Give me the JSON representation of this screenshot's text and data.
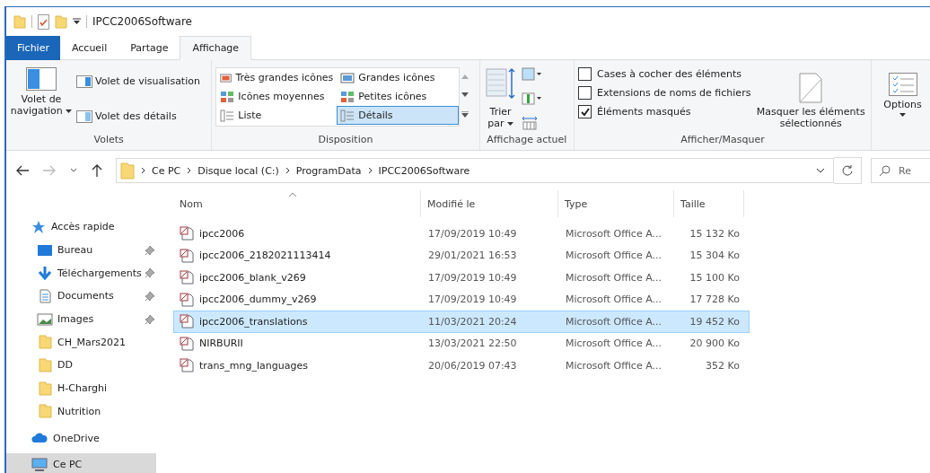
{
  "window": {
    "title": "IPCC2006Software"
  },
  "ribbon_tabs": [
    {
      "label": "Fichier",
      "kind": "file",
      "selected": false
    },
    {
      "label": "Accueil",
      "kind": "tab",
      "selected": false
    },
    {
      "label": "Partage",
      "kind": "tab",
      "selected": false
    },
    {
      "label": "Affichage",
      "kind": "tab",
      "selected": true
    }
  ],
  "ribbon": {
    "volets": {
      "label": "Volets",
      "navigation": "Volet de navigation",
      "panes": [
        {
          "label": "Volet de visualisation",
          "kind": "preview"
        },
        {
          "label": "Volet des détails",
          "kind": "details"
        }
      ]
    },
    "disposition": {
      "label": "Disposition",
      "layouts": [
        {
          "label": "Très grandes icônes",
          "kind": "xl",
          "selected": false
        },
        {
          "label": "Grandes icônes",
          "kind": "large",
          "selected": false
        },
        {
          "label": "Icônes moyennes",
          "kind": "medium",
          "selected": false
        },
        {
          "label": "Petites icônes",
          "kind": "small",
          "selected": false
        },
        {
          "label": "Liste",
          "kind": "list",
          "selected": false
        },
        {
          "label": "Détails",
          "kind": "details",
          "selected": true
        }
      ]
    },
    "current_view": {
      "label": "Affichage actuel",
      "sort": "Trier par"
    },
    "show_hide": {
      "label": "Afficher/Masquer",
      "checkboxes": [
        {
          "label": "Cases à cocher des éléments",
          "checked": false
        },
        {
          "label": "Extensions de noms de fichiers",
          "checked": false
        },
        {
          "label": "Éléments masqués",
          "checked": true
        }
      ],
      "hide_selected": "Masquer les éléments sélectionnés"
    },
    "options": "Options"
  },
  "address": {
    "breadcrumbs": [
      "Ce PC",
      "Disque local (C:)",
      "ProgramData",
      "IPCC2006Software"
    ],
    "search_placeholder": "Re"
  },
  "sidebar": [
    {
      "label": "Accès rapide",
      "kind": "star",
      "selected": false,
      "children": [
        {
          "label": "Bureau",
          "kind": "desktop",
          "pinned": true,
          "selected": false
        },
        {
          "label": "Téléchargements",
          "kind": "download",
          "pinned": true,
          "selected": false
        },
        {
          "label": "Documents",
          "kind": "document",
          "pinned": true,
          "selected": false
        },
        {
          "label": "Images",
          "kind": "image",
          "pinned": true,
          "selected": false
        },
        {
          "label": "CH_Mars2021",
          "kind": "folder",
          "pinned": false,
          "selected": false
        },
        {
          "label": "DD",
          "kind": "folder",
          "pinned": false,
          "selected": false
        },
        {
          "label": "H-Charghi",
          "kind": "folder",
          "pinned": false,
          "selected": false
        },
        {
          "label": "Nutrition",
          "kind": "folder",
          "pinned": false,
          "selected": false
        }
      ]
    },
    {
      "label": "OneDrive",
      "kind": "cloud",
      "selected": false
    },
    {
      "label": "Ce PC",
      "kind": "pc",
      "selected": true
    }
  ],
  "table": {
    "columns": [
      {
        "label": "Nom",
        "sorted": true
      },
      {
        "label": "Modifié le",
        "sorted": false
      },
      {
        "label": "Type",
        "sorted": false
      },
      {
        "label": "Taille",
        "sorted": false
      }
    ],
    "rows": [
      {
        "name": "ipcc2006",
        "modified": "17/09/2019 10:49",
        "type": "Microsoft Office A...",
        "size": "15 132 Ko",
        "selected": false
      },
      {
        "name": "ipcc2006_2182021113414",
        "modified": "29/01/2021 16:53",
        "type": "Microsoft Office A...",
        "size": "15 304 Ko",
        "selected": false
      },
      {
        "name": "ipcc2006_blank_v269",
        "modified": "17/09/2019 10:49",
        "type": "Microsoft Office A...",
        "size": "15 100 Ko",
        "selected": false
      },
      {
        "name": "ipcc2006_dummy_v269",
        "modified": "17/09/2019 10:49",
        "type": "Microsoft Office A...",
        "size": "17 728 Ko",
        "selected": false
      },
      {
        "name": "ipcc2006_translations",
        "modified": "11/03/2021 20:24",
        "type": "Microsoft Office A...",
        "size": "19 452 Ko",
        "selected": true
      },
      {
        "name": "NIRBURII",
        "modified": "13/03/2021 22:50",
        "type": "Microsoft Office A...",
        "size": "20 900 Ko",
        "selected": false
      },
      {
        "name": "trans_mng_languages",
        "modified": "20/06/2019 07:43",
        "type": "Microsoft Office A...",
        "size": "352 Ko",
        "selected": false
      }
    ]
  }
}
